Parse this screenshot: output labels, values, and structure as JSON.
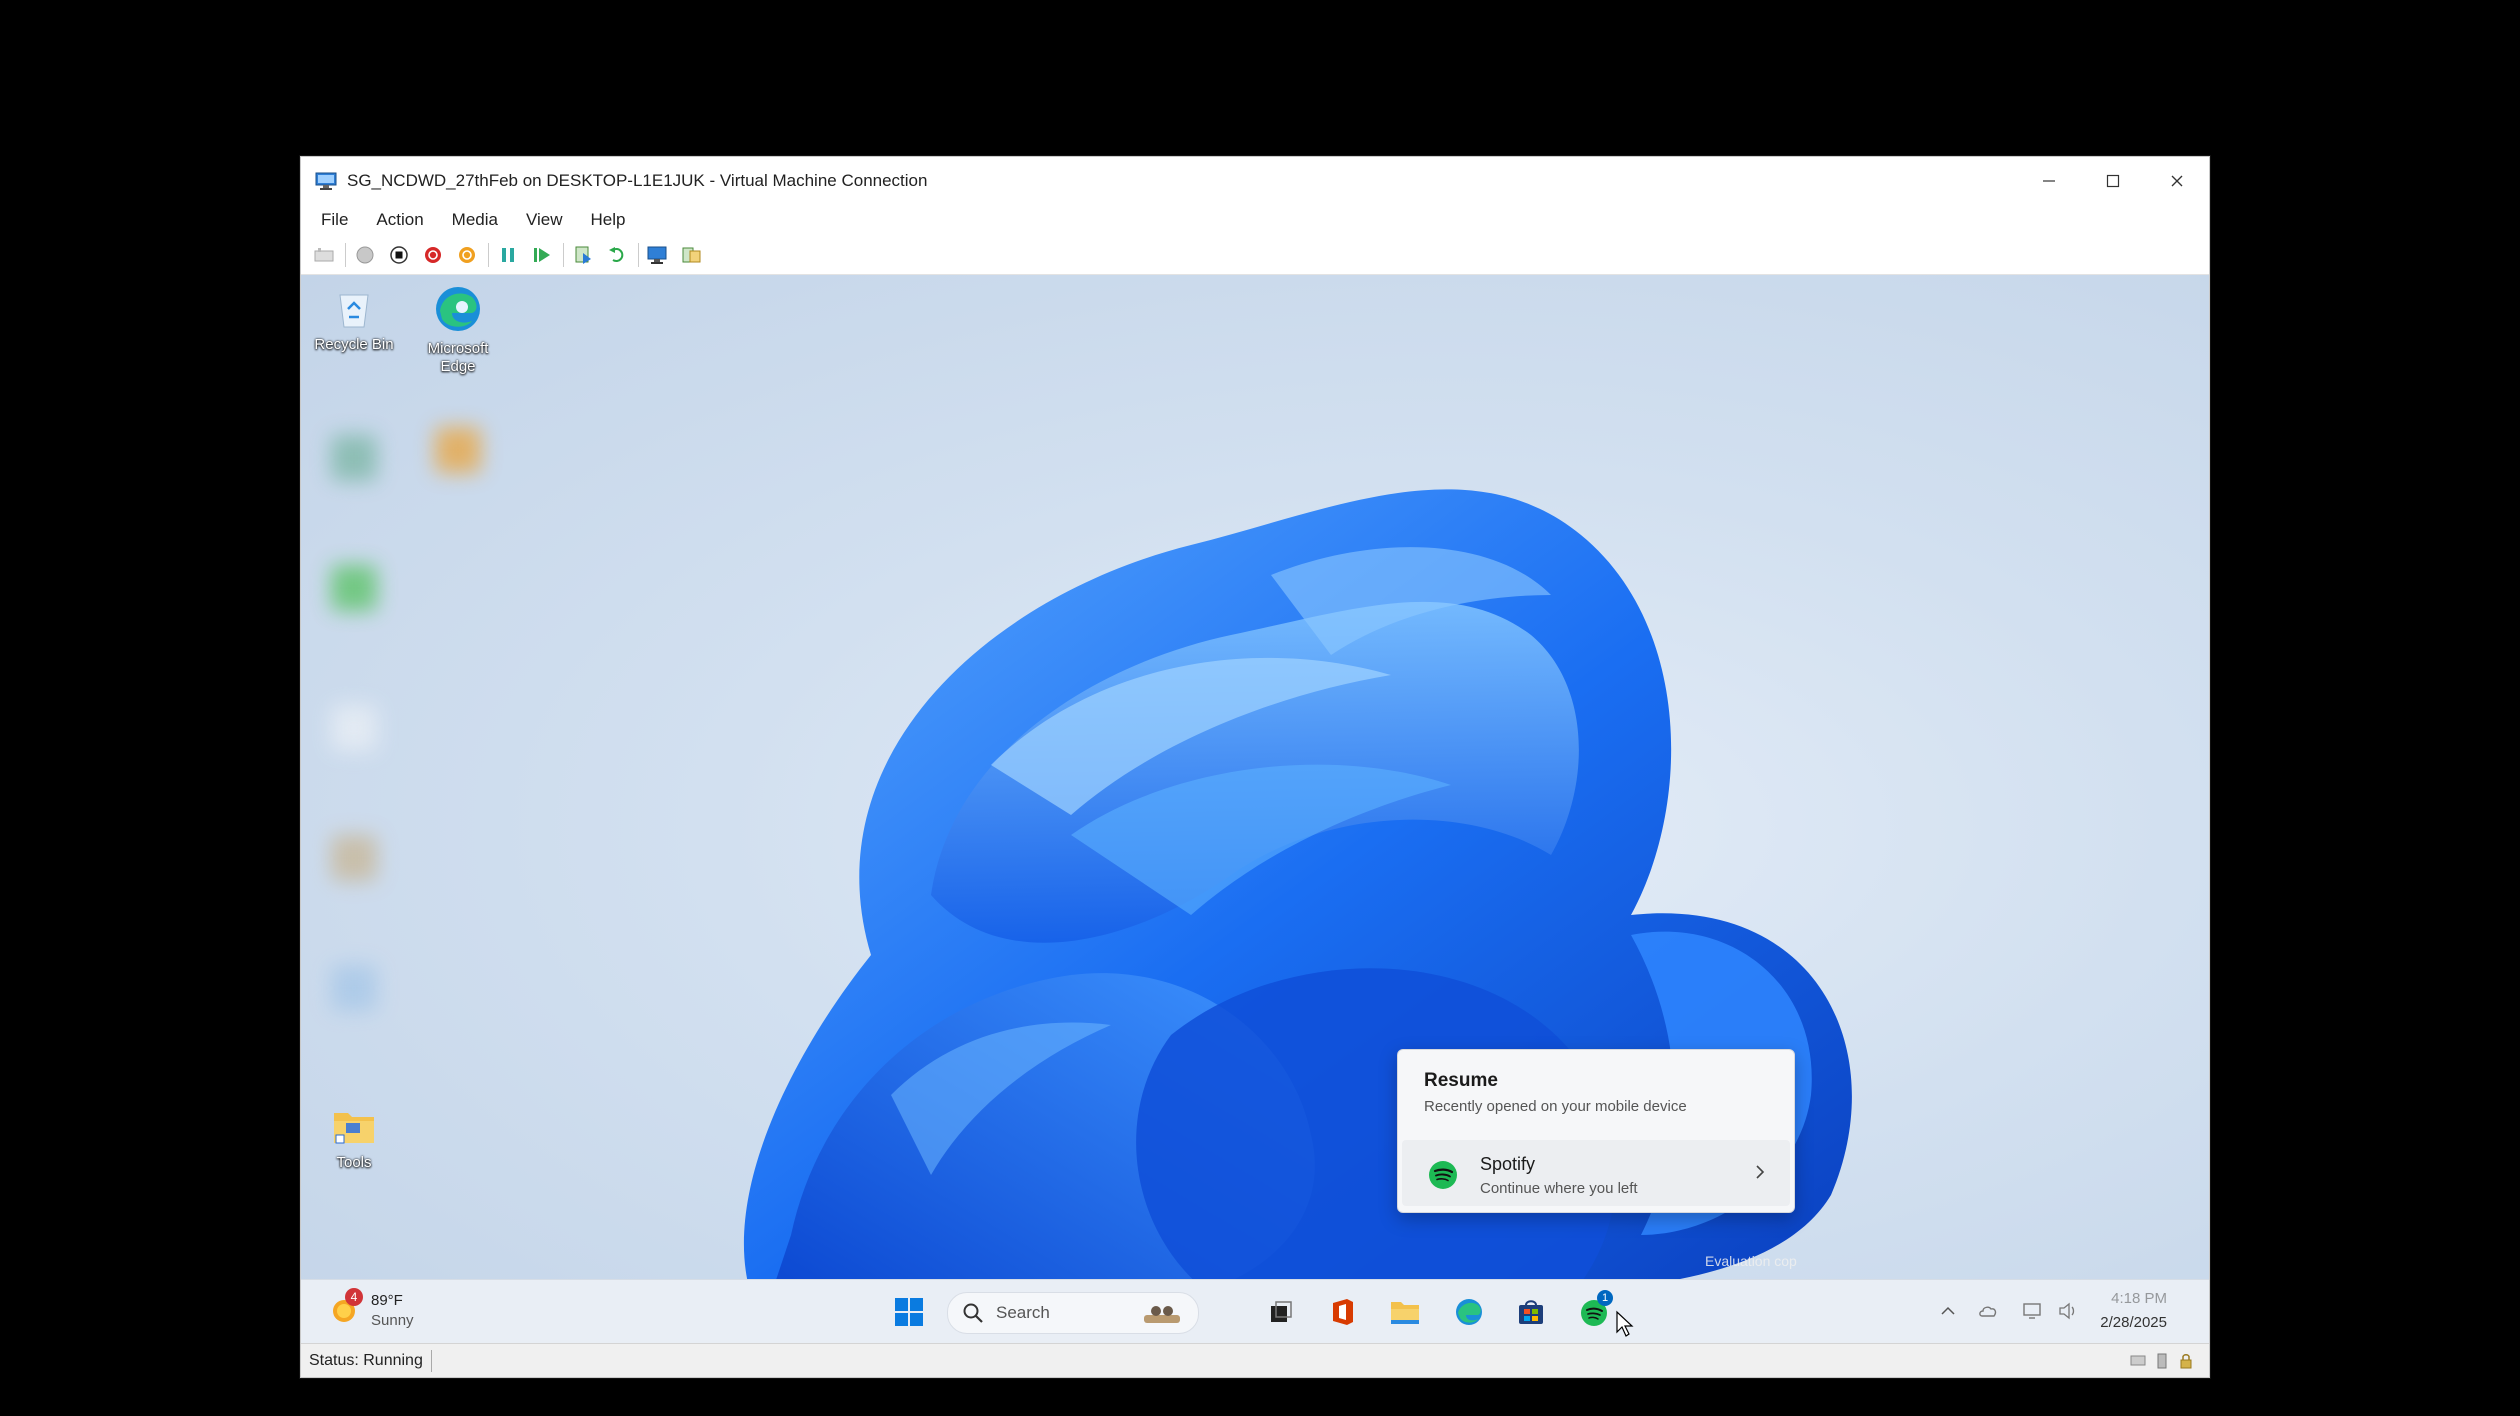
{
  "window": {
    "title": "SG_NCDWD_27thFeb on DESKTOP-L1E1JUK - Virtual Machine Connection",
    "menu": [
      "File",
      "Action",
      "Media",
      "View",
      "Help"
    ]
  },
  "desktop": {
    "icons": [
      {
        "label": "Recycle Bin",
        "icon": "recycle-bin-icon"
      },
      {
        "label": "Microsoft Edge",
        "icon": "edge-icon"
      },
      {
        "label": "Tools",
        "icon": "folder-icon"
      }
    ],
    "watermark": "Evaluation cop"
  },
  "popup": {
    "title": "Resume",
    "subtitle": "Recently opened on your mobile device",
    "app_name": "Spotify",
    "app_subtitle": "Continue where you left"
  },
  "taskbar": {
    "weather_badge": "4",
    "weather_temp": "89°F",
    "weather_condition": "Sunny",
    "search_placeholder": "Search",
    "spotify_badge": "1",
    "time": "4:18 PM",
    "date": "2/28/2025"
  },
  "status": {
    "text": "Status: Running"
  },
  "colors": {
    "accent": "#0067c0",
    "spotify_green": "#1db954",
    "desktop_bg": "#d2e0f0",
    "bloom_blue": "#1a6ef2"
  }
}
